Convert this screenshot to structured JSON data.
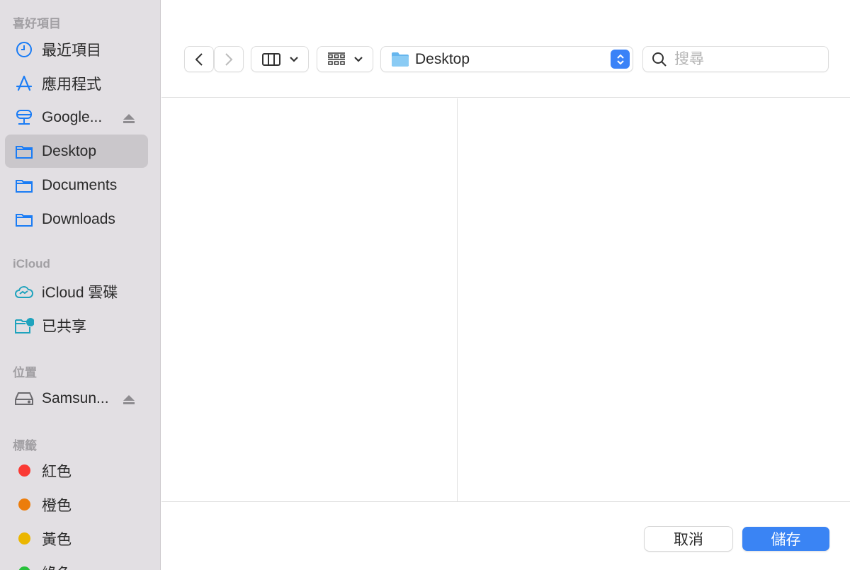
{
  "sidebar": {
    "favorites_header": "喜好項目",
    "favorites": [
      {
        "label": "最近項目",
        "icon": "clock-icon"
      },
      {
        "label": "應用程式",
        "icon": "apps-icon"
      },
      {
        "label": "Google...",
        "icon": "network-drive-icon",
        "eject": true
      },
      {
        "label": "Desktop",
        "icon": "folder-icon",
        "selected": true
      },
      {
        "label": "Documents",
        "icon": "folder-icon"
      },
      {
        "label": "Downloads",
        "icon": "folder-icon"
      }
    ],
    "icloud_header": "iCloud",
    "icloud": [
      {
        "label": "iCloud 雲碟",
        "icon": "icloud-icon"
      },
      {
        "label": "已共享",
        "icon": "shared-folder-icon"
      }
    ],
    "locations_header": "位置",
    "locations": [
      {
        "label": "Samsun...",
        "icon": "drive-icon",
        "eject": true
      }
    ],
    "tags_header": "標籤",
    "tags": [
      {
        "label": "紅色",
        "color": "#fa3a34"
      },
      {
        "label": "橙色",
        "color": "#ec7d0c"
      },
      {
        "label": "黃色",
        "color": "#ebb600"
      },
      {
        "label": "綠色",
        "color": "#27c13b"
      }
    ]
  },
  "toolbar": {
    "path": "Desktop",
    "search_placeholder": "搜尋"
  },
  "dialog": {
    "cancel": "取消",
    "save": "儲存"
  },
  "colors": {
    "accent": "#3a84f4",
    "icon_blue": "#1a7cf5"
  }
}
